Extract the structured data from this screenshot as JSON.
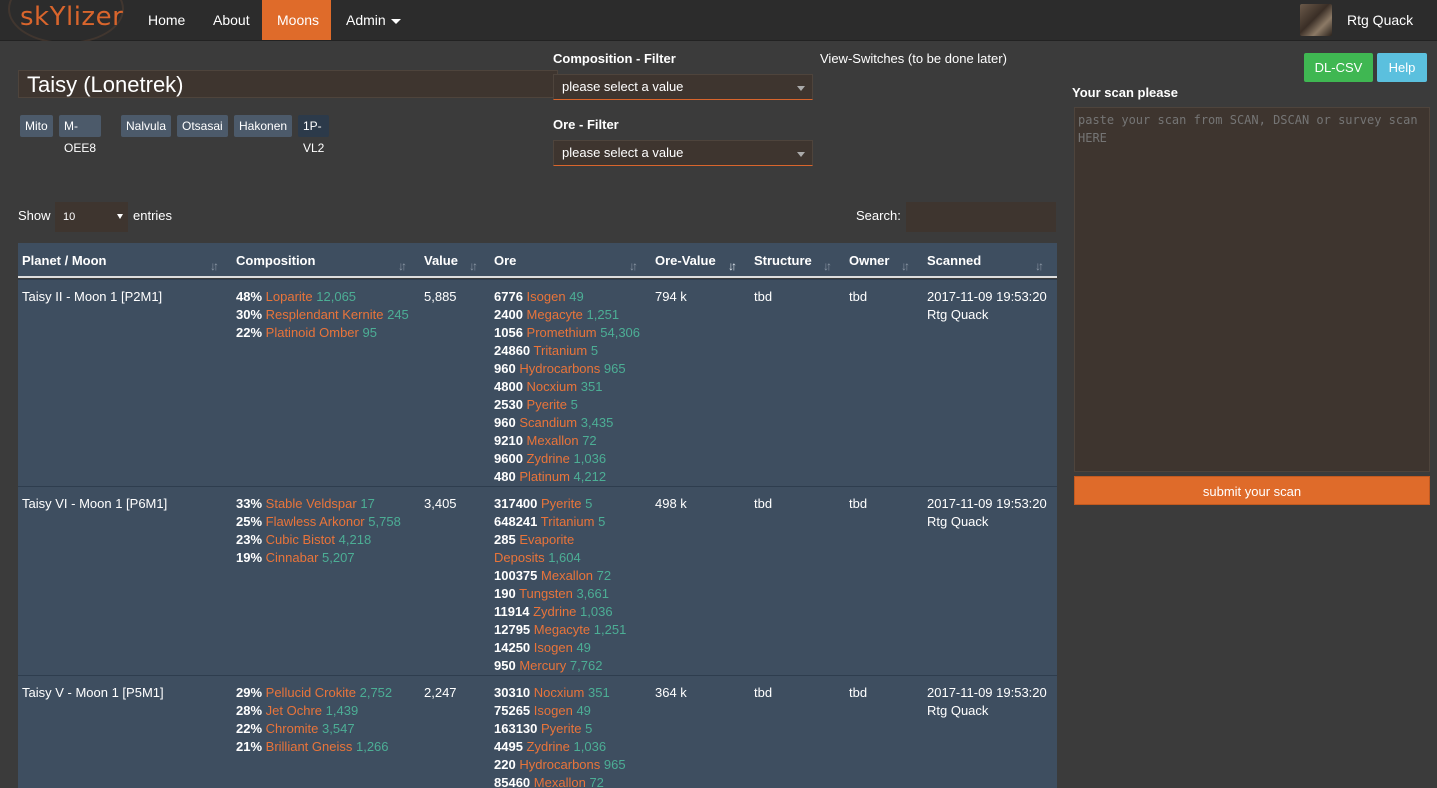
{
  "brand": "skYlizer",
  "nav": {
    "items": [
      {
        "label": "Home"
      },
      {
        "label": "About"
      },
      {
        "label": "Moons"
      },
      {
        "label": "Admin"
      }
    ],
    "user": "Rtg Quack"
  },
  "page": {
    "title": "Taisy (Lonetrek)",
    "systems": [
      "Mito",
      "M-OEE8",
      "Nalvula",
      "Otsasai",
      "Hakonen",
      "1P-VL2"
    ]
  },
  "filters": {
    "composition_label": "Composition - Filter",
    "composition_value": "please select a value",
    "ore_label": "Ore - Filter",
    "ore_value": "please select a value",
    "view_switches": "View-Switches (to be done later)"
  },
  "buttons": {
    "dl_csv": "DL-CSV",
    "help": "Help"
  },
  "scan": {
    "label": "Your scan please",
    "placeholder": "paste your scan from SCAN, DSCAN or survey scan HERE",
    "submit": "submit your scan"
  },
  "table_controls": {
    "show": "Show",
    "length": "10",
    "entries": "entries",
    "search": "Search:"
  },
  "table": {
    "columns": [
      "Planet / Moon",
      "Composition",
      "Value",
      "Ore",
      "Ore-Value",
      "Structure",
      "Owner",
      "Scanned"
    ],
    "rows": [
      {
        "moon": "Taisy II - Moon 1  [P2M1]",
        "composition": [
          {
            "pct": "48%",
            "name": "Loparite",
            "val": "12,065"
          },
          {
            "pct": "30%",
            "name": "Resplendant Kernite",
            "val": "245"
          },
          {
            "pct": "22%",
            "name": "Platinoid Omber",
            "val": "95"
          }
        ],
        "value": "5,885",
        "ore": [
          {
            "qty": "6776",
            "name": "Isogen",
            "val": "49"
          },
          {
            "qty": "2400",
            "name": "Megacyte",
            "val": "1,251"
          },
          {
            "qty": "1056",
            "name": "Promethium",
            "val": "54,306"
          },
          {
            "qty": "24860",
            "name": "Tritanium",
            "val": "5"
          },
          {
            "qty": "960",
            "name": "Hydrocarbons",
            "val": "965"
          },
          {
            "qty": "4800",
            "name": "Nocxium",
            "val": "351"
          },
          {
            "qty": "2530",
            "name": "Pyerite",
            "val": "5"
          },
          {
            "qty": "960",
            "name": "Scandium",
            "val": "3,435"
          },
          {
            "qty": "9210",
            "name": "Mexallon",
            "val": "72"
          },
          {
            "qty": "9600",
            "name": "Zydrine",
            "val": "1,036"
          },
          {
            "qty": "480",
            "name": "Platinum",
            "val": "4,212"
          }
        ],
        "ore_value": "794 k",
        "structure": "tbd",
        "owner": "tbd",
        "scanned_date": "2017-11-09 19:53:20",
        "scanned_by": "Rtg Quack"
      },
      {
        "moon": "Taisy VI - Moon 1  [P6M1]",
        "composition": [
          {
            "pct": "33%",
            "name": "Stable Veldspar",
            "val": "17"
          },
          {
            "pct": "25%",
            "name": "Flawless Arkonor",
            "val": "5,758"
          },
          {
            "pct": "23%",
            "name": "Cubic Bistot",
            "val": "4,218"
          },
          {
            "pct": "19%",
            "name": "Cinnabar",
            "val": "5,207"
          }
        ],
        "value": "3,405",
        "ore": [
          {
            "qty": "317400",
            "name": "Pyerite",
            "val": "5"
          },
          {
            "qty": "648241",
            "name": "Tritanium",
            "val": "5"
          },
          {
            "qty": "285",
            "name": "Evaporite",
            "val": ""
          },
          {
            "qty": "",
            "name": "Deposits",
            "val": "1,604"
          },
          {
            "qty": "100375",
            "name": "Mexallon",
            "val": "72"
          },
          {
            "qty": "190",
            "name": "Tungsten",
            "val": "3,661"
          },
          {
            "qty": "11914",
            "name": "Zydrine",
            "val": "1,036"
          },
          {
            "qty": "12795",
            "name": "Megacyte",
            "val": "1,251"
          },
          {
            "qty": "14250",
            "name": "Isogen",
            "val": "49"
          },
          {
            "qty": "950",
            "name": "Mercury",
            "val": "7,762"
          }
        ],
        "ore_value": "498 k",
        "structure": "tbd",
        "owner": "tbd",
        "scanned_date": "2017-11-09 19:53:20",
        "scanned_by": "Rtg Quack"
      },
      {
        "moon": "Taisy V - Moon 1  [P5M1]",
        "composition": [
          {
            "pct": "29%",
            "name": "Pellucid Crokite",
            "val": "2,752"
          },
          {
            "pct": "28%",
            "name": "Jet Ochre",
            "val": "1,439"
          },
          {
            "pct": "22%",
            "name": "Chromite",
            "val": "3,547"
          },
          {
            "pct": "21%",
            "name": "Brilliant Gneiss",
            "val": "1,266"
          }
        ],
        "value": "2,247",
        "ore": [
          {
            "qty": "30310",
            "name": "Nocxium",
            "val": "351"
          },
          {
            "qty": "75265",
            "name": "Isogen",
            "val": "49"
          },
          {
            "qty": "163130",
            "name": "Pyerite",
            "val": "5"
          },
          {
            "qty": "4495",
            "name": "Zydrine",
            "val": "1,036"
          },
          {
            "qty": "220",
            "name": "Hydrocarbons",
            "val": "965"
          },
          {
            "qty": "85460",
            "name": "Mexallon",
            "val": "72"
          }
        ],
        "ore_value": "364 k",
        "structure": "tbd",
        "owner": "tbd",
        "scanned_date": "2017-11-09 19:53:20",
        "scanned_by": "Rtg Quack"
      }
    ]
  }
}
